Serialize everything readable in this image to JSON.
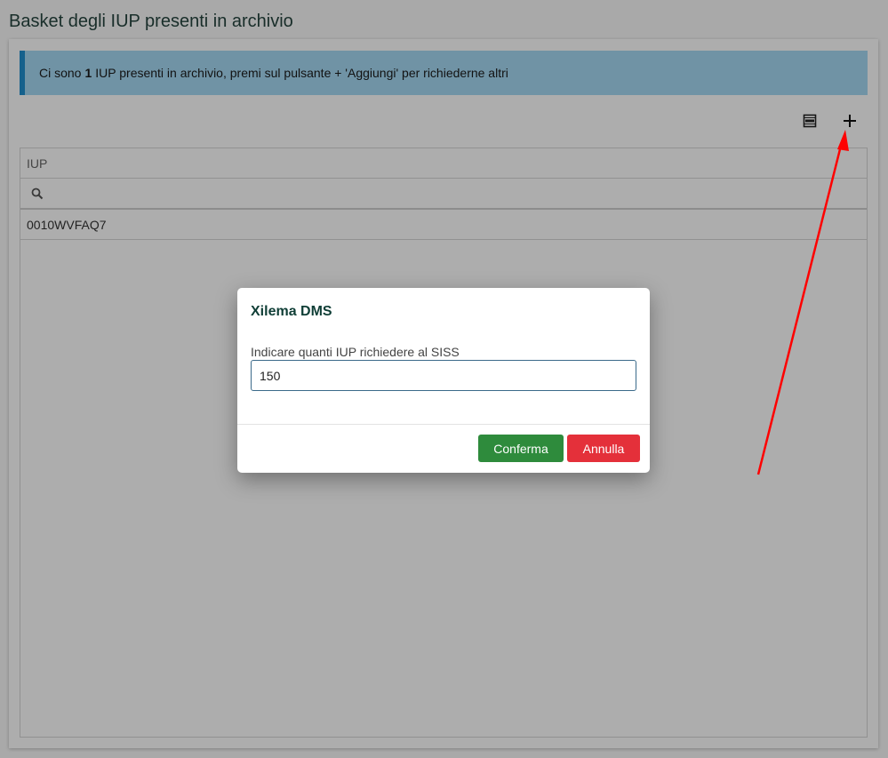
{
  "page": {
    "title": "Basket degli IUP presenti in archivio"
  },
  "banner": {
    "text_before": "Ci sono",
    "count": "1",
    "text_after": "IUP presenti in archivio, premi sul pulsante + 'Aggiungi' per richiederne altri"
  },
  "toolbar": {
    "export_icon": "xlsx-export-icon",
    "add_icon": "plus-icon"
  },
  "grid": {
    "column_header": "IUP",
    "filter_icon": "search-icon",
    "filter_value": "",
    "rows": [
      "0010WVFAQ7"
    ]
  },
  "dialog": {
    "title": "Xilema DMS",
    "label": "Indicare quanti IUP richiedere al SISS",
    "input_value": "150",
    "confirm_label": "Conferma",
    "cancel_label": "Annulla"
  },
  "annotation": {
    "arrow_color": "#ff0000"
  },
  "colors": {
    "banner_bg": "#a5d9f3",
    "banner_accent": "#1f8fcf",
    "confirm": "#2e8b3c",
    "cancel": "#e4303a",
    "title": "#0f3e36"
  }
}
